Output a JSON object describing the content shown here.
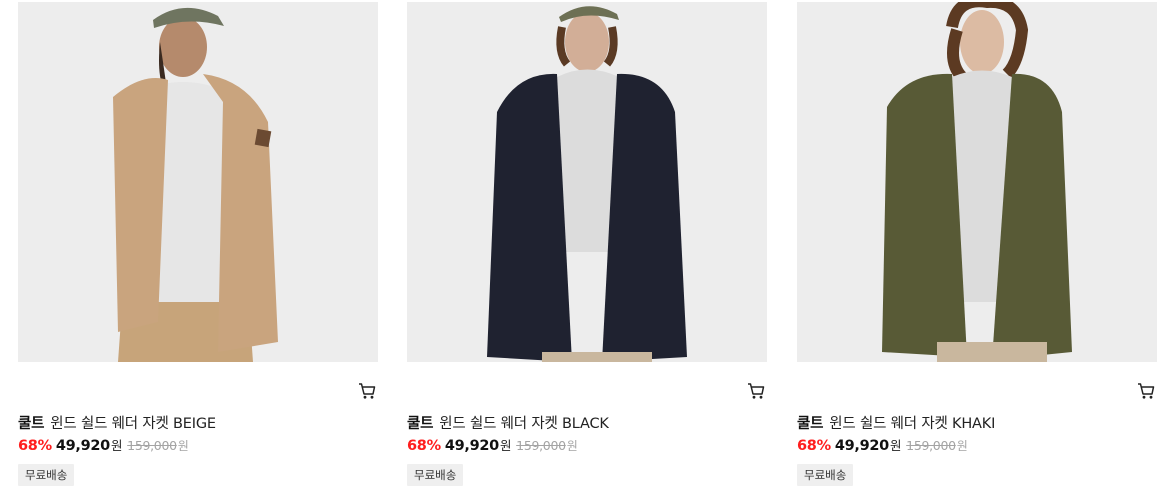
{
  "products": [
    {
      "brand": "쿨트",
      "name": "윈드 쉴드 웨더 자켓 BEIGE",
      "discount_rate": "68%",
      "sale_price": "49,920",
      "sale_unit": "원",
      "original_price": "159,000",
      "original_unit": "원",
      "badge": "무료배송",
      "jacket_color": "#c9a47e"
    },
    {
      "brand": "쿨트",
      "name": "윈드 쉴드 웨더 자켓 BLACK",
      "discount_rate": "68%",
      "sale_price": "49,920",
      "sale_unit": "원",
      "original_price": "159,000",
      "original_unit": "원",
      "badge": "무료배송",
      "jacket_color": "#1f2230"
    },
    {
      "brand": "쿨트",
      "name": "윈드 쉴드 웨더 자켓 KHAKI",
      "discount_rate": "68%",
      "sale_price": "49,920",
      "sale_unit": "원",
      "original_price": "159,000",
      "original_unit": "원",
      "badge": "무료배송",
      "jacket_color": "#585a36"
    }
  ]
}
